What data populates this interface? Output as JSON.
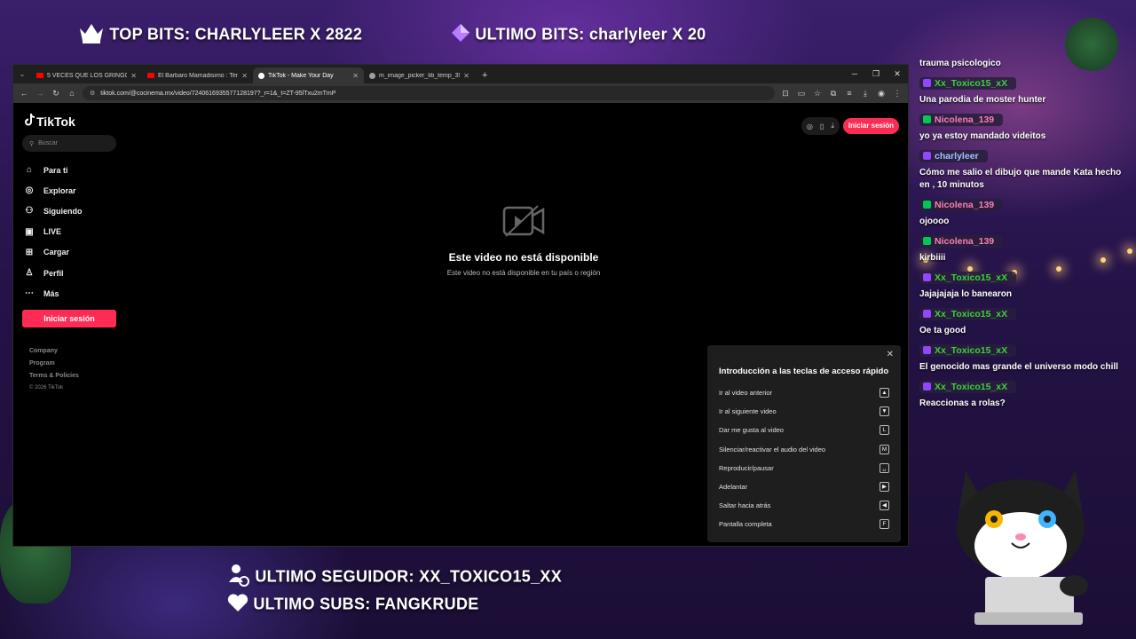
{
  "overlay": {
    "top_bits": "TOP BITS: CHARLYLEER X 2822",
    "ultimo_bits": "ULTIMO BITS: charlyleer X 20",
    "ultimo_seguidor": "ULTIMO SEGUIDOR: XX_TOXICO15_XX",
    "ultimo_subs": "ULTIMO SUBS: FANGKRUDE"
  },
  "browser": {
    "tabs": [
      {
        "title": "5 VECES QUE LOS GRINGOS AMAR",
        "favicon_color": "#ff0000"
      },
      {
        "title": "El Barbaro Mamadisimo : Temp",
        "favicon_color": "#ff0000"
      },
      {
        "title": "TikTok - Make Your Day",
        "favicon_color": "#ffffff"
      },
      {
        "title": "m_image_picker_lib_temp_3956",
        "favicon_color": "#9aa0a6"
      }
    ],
    "url": "tiktok.com/@cocinema.mx/video/7240616935577128197?_r=1&_t=ZT-95lTxu2mTmP"
  },
  "tiktok": {
    "logo": "TikTok",
    "search_placeholder": "Buscar",
    "nav": [
      {
        "label": "Para ti",
        "icon": "home-icon",
        "glyph": "⌂"
      },
      {
        "label": "Explorar",
        "icon": "compass-icon",
        "glyph": "◎"
      },
      {
        "label": "Siguiendo",
        "icon": "following-icon",
        "glyph": "⚇"
      },
      {
        "label": "LIVE",
        "icon": "live-icon",
        "glyph": "▣"
      },
      {
        "label": "Cargar",
        "icon": "upload-icon",
        "glyph": "⊞"
      },
      {
        "label": "Perfil",
        "icon": "profile-icon",
        "glyph": "♙"
      },
      {
        "label": "Más",
        "icon": "more-icon",
        "glyph": "⋯"
      }
    ],
    "login_label": "Iniciar sesión",
    "footer": [
      "Company",
      "Program",
      "Terms & Policies"
    ],
    "copyright": "© 2026 TikTok",
    "unavailable_title": "Este video no está disponible",
    "unavailable_sub": "Este video no está disponible en tu país o región",
    "shortcuts": {
      "title": "Introducción a las teclas de acceso rápido",
      "items": [
        {
          "label": "Ir al video anterior",
          "key": "▲"
        },
        {
          "label": "Ir al siguiente video",
          "key": "▼"
        },
        {
          "label": "Dar me gusta al video",
          "key": "L"
        },
        {
          "label": "Silenciar/reactivar el audio del video",
          "key": "M"
        },
        {
          "label": "Reproducir/pausar",
          "key": "␣"
        },
        {
          "label": "Adelantar",
          "key": "▶"
        },
        {
          "label": "Saltar hacia atrás",
          "key": "◀"
        },
        {
          "label": "Pantalla completa",
          "key": "F"
        }
      ]
    }
  },
  "chat": {
    "first_text": "trauma psicologico",
    "messages": [
      {
        "user": "Xx_Toxico15_xX",
        "color": "#3bd13b",
        "badge_color": "#9146ff",
        "text": "Una parodia de moster hunter"
      },
      {
        "user": "Nicolena_139",
        "color": "#ff7eb6",
        "badge_color": "#00c853",
        "text": "yo ya estoy mandado videitos"
      },
      {
        "user": "charlyleer",
        "color": "#9fc4ff",
        "badge_color": "#9146ff",
        "text": "Cómo me salio el dibujo que mande Kata hecho en , 10 minutos"
      },
      {
        "user": "Nicolena_139",
        "color": "#ff7eb6",
        "badge_color": "#00c853",
        "text": "ojoooo"
      },
      {
        "user": "Nicolena_139",
        "color": "#ff7eb6",
        "badge_color": "#00c853",
        "text": "kirbiiii"
      },
      {
        "user": "Xx_Toxico15_xX",
        "color": "#3bd13b",
        "badge_color": "#9146ff",
        "text": "Jajajajaja   lo banearon"
      },
      {
        "user": "Xx_Toxico15_xX",
        "color": "#3bd13b",
        "badge_color": "#9146ff",
        "text": "Oe ta good"
      },
      {
        "user": "Xx_Toxico15_xX",
        "color": "#3bd13b",
        "badge_color": "#9146ff",
        "text": "El genocido mas grande el universo modo chill"
      },
      {
        "user": "Xx_Toxico15_xX",
        "color": "#3bd13b",
        "badge_color": "#9146ff",
        "text": "Reaccionas a rolas?"
      }
    ]
  }
}
